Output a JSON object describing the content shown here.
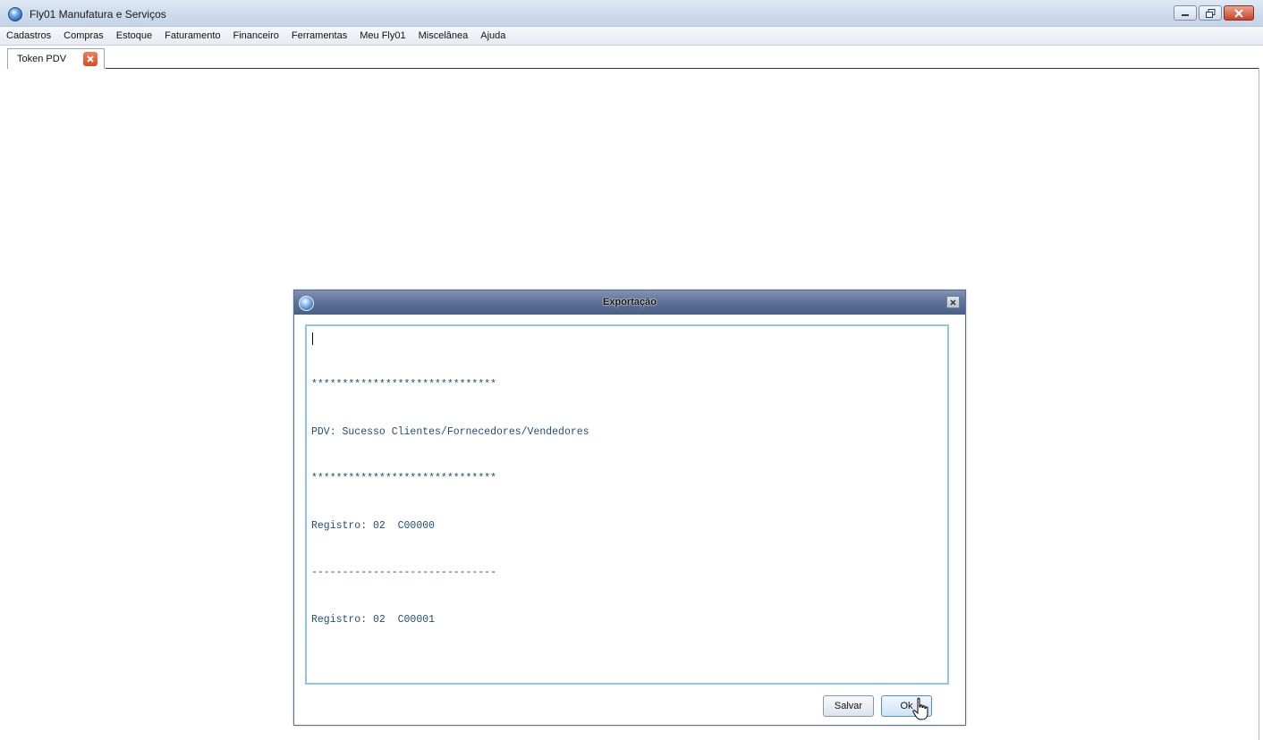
{
  "window": {
    "title": "Fly01 Manufatura e Serviços",
    "controls": [
      "minimize",
      "restore",
      "close"
    ]
  },
  "menu": {
    "items": [
      "Cadastros",
      "Compras",
      "Estoque",
      "Faturamento",
      "Financeiro",
      "Ferramentas",
      "Meu Fly01",
      "Miscelânea",
      "Ajuda"
    ]
  },
  "tabs": [
    {
      "label": "Token PDV",
      "close_icon": "close-icon"
    }
  ],
  "dialog": {
    "title": "Exportação",
    "log_lines": [
      "******************************",
      "PDV: Sucesso Clientes/Fornecedores/Vendedores",
      "******************************",
      "Registro: 02  C00000",
      "------------------------------",
      "Registro: 02  C00001"
    ],
    "buttons": {
      "save": "Salvar",
      "ok": "Ok"
    }
  },
  "colors": {
    "log_text": "#1f4e79",
    "dialog_title_bar": "#5d7196",
    "log_border": "#8fc3ec"
  }
}
